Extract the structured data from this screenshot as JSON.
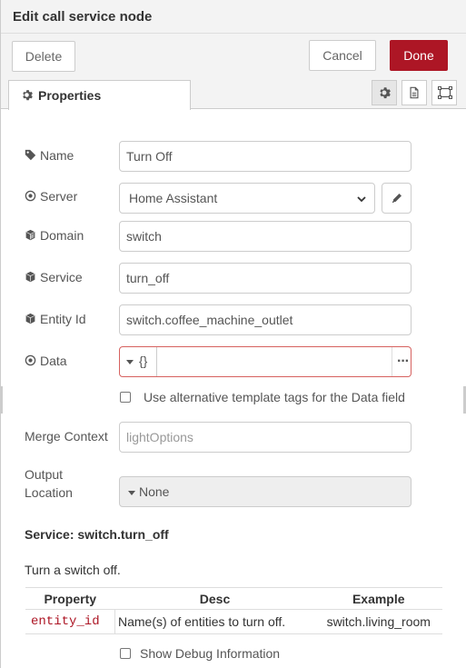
{
  "dialog": {
    "title": "Edit call service node"
  },
  "toolbar": {
    "delete_label": "Delete",
    "cancel_label": "Cancel",
    "done_label": "Done"
  },
  "tabs": {
    "properties_label": "Properties"
  },
  "form": {
    "name_label": "Name",
    "name_value": "Turn Off",
    "server_label": "Server",
    "server_value": "Home Assistant",
    "domain_label": "Domain",
    "domain_value": "switch",
    "service_label": "Service",
    "service_value": "turn_off",
    "entity_label": "Entity Id",
    "entity_value": "switch.coffee_machine_outlet",
    "data_label": "Data",
    "data_type": "{}",
    "alt_tags_label": "Use alternative template tags for the Data field",
    "merge_label": "Merge Context",
    "merge_placeholder": "lightOptions",
    "output_label_1": "Output",
    "output_label_2": "Location",
    "output_value": "None"
  },
  "service_info": {
    "title": "Service: switch.turn_off",
    "description": "Turn a switch off.",
    "headers": [
      "Property",
      "Desc",
      "Example"
    ],
    "rows": [
      {
        "property": "entity_id",
        "desc": "Name(s) of entities to turn off.",
        "example": "switch.living_room"
      }
    ]
  },
  "debug": {
    "label": "Show Debug Information"
  },
  "colors": {
    "done": "#ad1625",
    "code": "#ad1625",
    "data_border": "#d6615f"
  }
}
